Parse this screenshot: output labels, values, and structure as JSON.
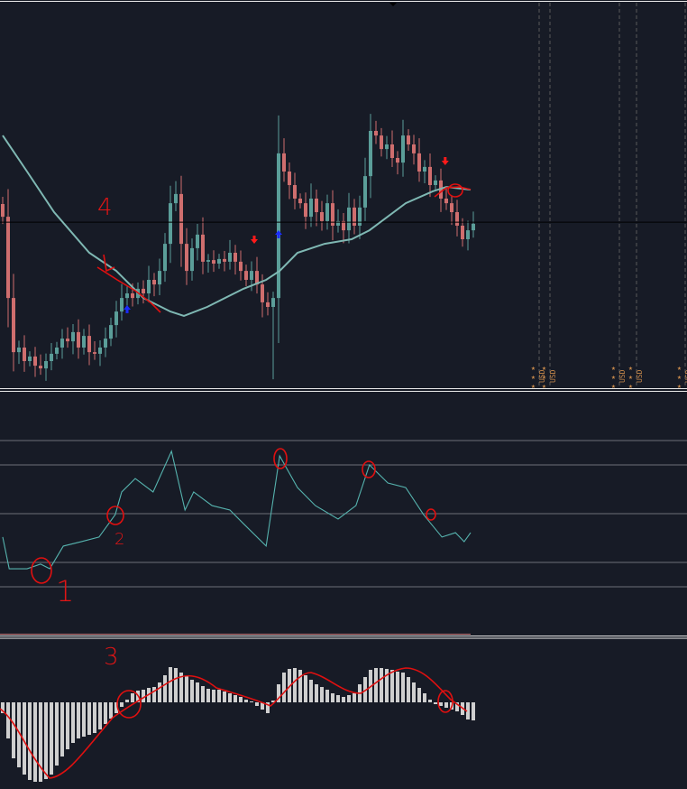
{
  "chart_data": [
    {
      "type": "candlestick",
      "panel": "price",
      "title": "",
      "colors": {
        "bull": "#5b9e99",
        "bear": "#cf6e6e",
        "ma": "#7fb8b3",
        "level": "#000000",
        "arrow_up": "#1a2bff",
        "arrow_down": "#ff1a1a"
      },
      "ylim": [
        0,
        143
      ],
      "closes": [
        63.3,
        33.3,
        13.3,
        15,
        10,
        11.7,
        8.3,
        7.3,
        10,
        12.7,
        15,
        18.3,
        17.3,
        20.7,
        15,
        19.3,
        13.3,
        12.7,
        15,
        18.3,
        23.3,
        28.3,
        33.3,
        35,
        33.3,
        36.7,
        35,
        40,
        38.3,
        43.3,
        53.3,
        68.3,
        71.7,
        53.3,
        43.3,
        51.7,
        56.7,
        46.7,
        47.3,
        46,
        47.7,
        46.7,
        50,
        46.7,
        43.3,
        40,
        43.3,
        38.3,
        31.7,
        30,
        33.3,
        86.7,
        80,
        75,
        70,
        68.3,
        63.3,
        70,
        65,
        61.7,
        68.3,
        60,
        61.7,
        58.3,
        66.7,
        60,
        66.7,
        78.3,
        95,
        93.3,
        88.3,
        90,
        85,
        83.3,
        93.3,
        90,
        86.7,
        80,
        81.7,
        75,
        76.7,
        70,
        68.3,
        65,
        60,
        55,
        58.3,
        60.7
      ],
      "first_open": 68,
      "wick_extremes": [
        {
          "index": 50,
          "low": 3.3
        },
        {
          "index": 51,
          "high": 100.7
        }
      ],
      "moving_average": [
        [
          0,
          93.3
        ],
        [
          4.5,
          80
        ],
        [
          9.5,
          65
        ],
        [
          16,
          50
        ],
        [
          21,
          43.3
        ],
        [
          26,
          33.3
        ],
        [
          31,
          28.3
        ],
        [
          33.5,
          26.7
        ],
        [
          37.8,
          30
        ],
        [
          44.5,
          36.7
        ],
        [
          48.7,
          40
        ],
        [
          51.2,
          43.3
        ],
        [
          54.5,
          50
        ],
        [
          59.5,
          53.3
        ],
        [
          64.5,
          55
        ],
        [
          67.8,
          58.3
        ],
        [
          74.5,
          68.3
        ],
        [
          79.5,
          72.7
        ],
        [
          82,
          74.3
        ],
        [
          86.5,
          73.3
        ]
      ],
      "level_line": 61.3,
      "signals": [
        {
          "index": 23,
          "dir": "up"
        },
        {
          "index": 46.5,
          "dir": "down"
        },
        {
          "index": 51,
          "dir": "up"
        },
        {
          "index": 81.8,
          "dir": "down"
        }
      ],
      "events": [
        {
          "label": "USD",
          "stars": 3
        },
        {
          "label": "USD",
          "stars": 3
        },
        {
          "label": "USD",
          "stars": 3
        },
        {
          "label": "USD",
          "stars": 3
        },
        {
          "label": "USD",
          "stars": 3
        }
      ]
    },
    {
      "type": "line",
      "panel": "oscillator",
      "color": "#56b3ae",
      "levels": [
        80,
        70,
        50,
        30,
        20
      ],
      "ylim": [
        0,
        100
      ],
      "points": [
        [
          0,
          40.4
        ],
        [
          1.2,
          27.4
        ],
        [
          4.5,
          27.4
        ],
        [
          7,
          29.3
        ],
        [
          8.7,
          27.4
        ],
        [
          11.2,
          36.7
        ],
        [
          14.5,
          38.5
        ],
        [
          17.8,
          40.4
        ],
        [
          20.8,
          49.6
        ],
        [
          22,
          58.9
        ],
        [
          24.5,
          64.4
        ],
        [
          27.8,
          58.9
        ],
        [
          31.2,
          75.6
        ],
        [
          33.7,
          51.5
        ],
        [
          35.3,
          58.9
        ],
        [
          38.7,
          53.3
        ],
        [
          42,
          51.5
        ],
        [
          44.5,
          45.9
        ],
        [
          48.7,
          36.7
        ],
        [
          51.2,
          73.7
        ],
        [
          54.5,
          60.7
        ],
        [
          57.8,
          53.3
        ],
        [
          62,
          47.8
        ],
        [
          65.3,
          53.3
        ],
        [
          67.8,
          70
        ],
        [
          71.2,
          62.6
        ],
        [
          74.5,
          60.7
        ],
        [
          77.8,
          49.6
        ],
        [
          81.2,
          40.4
        ],
        [
          83.7,
          42.2
        ],
        [
          85.3,
          38.5
        ],
        [
          86.5,
          42.2
        ]
      ]
    },
    {
      "type": "bar",
      "panel": "macd-histogram",
      "color": "#cfcfcf",
      "values": [
        -0.12,
        -0.4,
        -0.62,
        -0.72,
        -0.8,
        -0.86,
        -0.88,
        -0.88,
        -0.85,
        -0.8,
        -0.7,
        -0.6,
        -0.52,
        -0.45,
        -0.4,
        -0.38,
        -0.36,
        -0.34,
        -0.3,
        -0.24,
        -0.18,
        -0.12,
        -0.05,
        0.03,
        0.1,
        0.13,
        0.14,
        0.16,
        0.17,
        0.22,
        0.3,
        0.39,
        0.38,
        0.33,
        0.29,
        0.25,
        0.22,
        0.18,
        0.15,
        0.14,
        0.14,
        0.12,
        0.1,
        0.08,
        0.06,
        0.03,
        0.01,
        -0.04,
        -0.08,
        -0.12,
        0.02,
        0.2,
        0.33,
        0.37,
        0.38,
        0.36,
        0.3,
        0.25,
        0.2,
        0.17,
        0.14,
        0.1,
        0.08,
        0.06,
        0.08,
        0.1,
        0.2,
        0.28,
        0.36,
        0.38,
        0.38,
        0.37,
        0.36,
        0.34,
        0.33,
        0.28,
        0.22,
        0.16,
        0.1,
        0.03,
        -0.02,
        -0.04,
        -0.06,
        -0.08,
        -0.1,
        -0.14,
        -0.19,
        -0.2
      ]
    }
  ],
  "annotations": {
    "label_4": "4",
    "label_1": "1",
    "label_2": "2",
    "label_3": "3"
  }
}
